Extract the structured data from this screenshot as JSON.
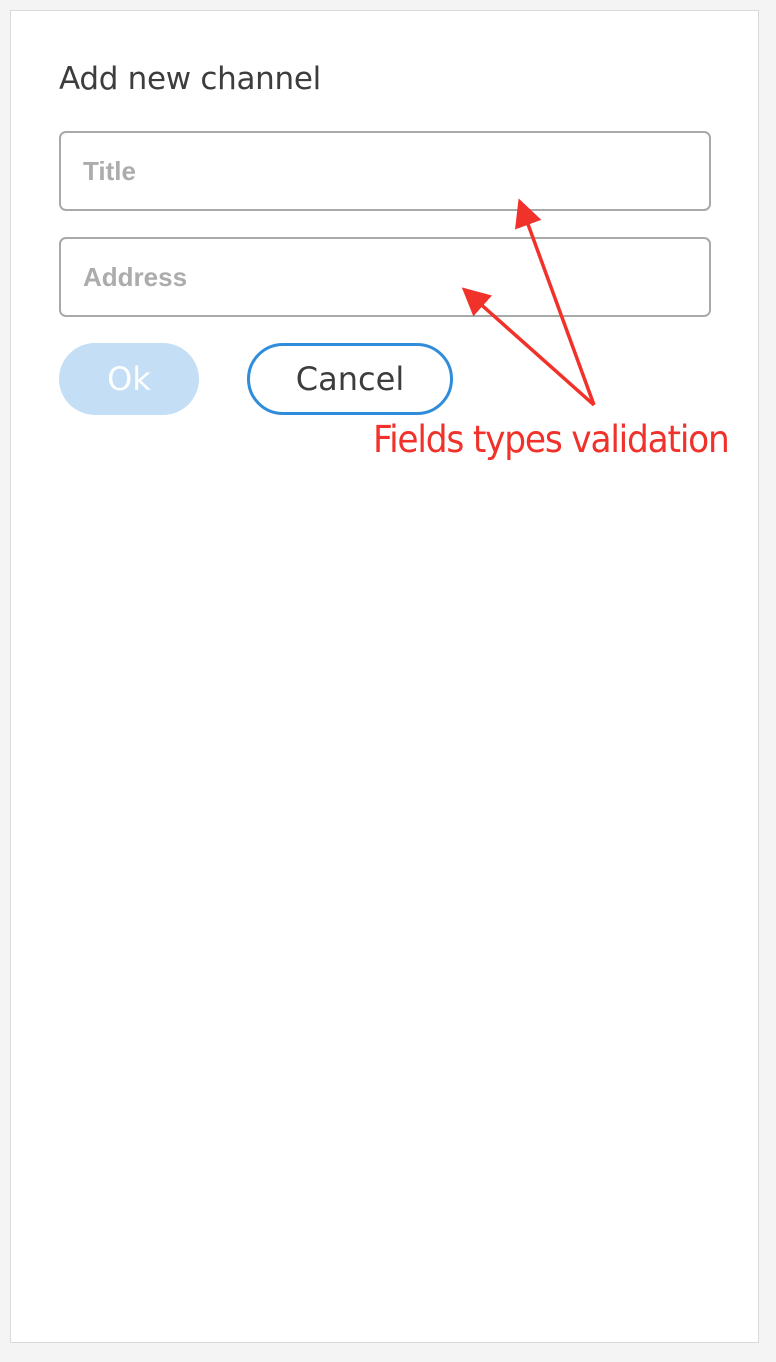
{
  "dialog": {
    "title": "Add new channel",
    "fields": {
      "title": {
        "placeholder": "Title",
        "value": ""
      },
      "address": {
        "placeholder": "Address",
        "value": ""
      }
    },
    "buttons": {
      "ok_label": "Ok",
      "ok_state": "disabled",
      "cancel_label": "Cancel"
    }
  },
  "annotation": {
    "text": "Fields types validation",
    "color": "#f0322a"
  },
  "colors": {
    "accent": "#2f8ddb",
    "ok_disabled": "#c4def5",
    "field_border": "#a9a9a9",
    "placeholder": "#acacac"
  }
}
